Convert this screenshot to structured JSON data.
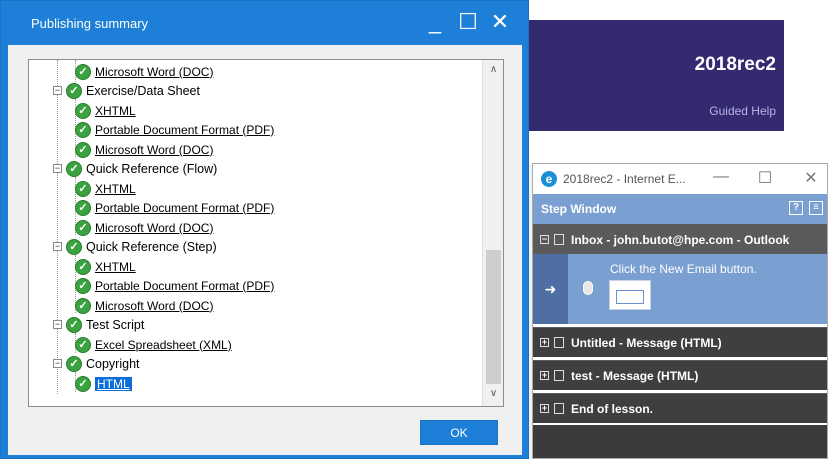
{
  "background_app": {
    "title": "2018rec2",
    "subtitle": "Guided Help"
  },
  "dialog": {
    "title": "Publishing summary",
    "controls": {
      "minimize": "_",
      "maximize": "☐",
      "close": "✕"
    },
    "ok_label": "OK",
    "scroll_up": "∧",
    "scroll_down": "∨",
    "tree": [
      {
        "label": "Microsoft Word (DOC)",
        "kind": "leaf"
      },
      {
        "label": "Exercise/Data Sheet",
        "kind": "node"
      },
      {
        "label": "XHTML",
        "kind": "leaf"
      },
      {
        "label": "Portable Document Format (PDF)",
        "kind": "leaf"
      },
      {
        "label": "Microsoft Word (DOC)",
        "kind": "leaf"
      },
      {
        "label": "Quick Reference (Flow)",
        "kind": "node"
      },
      {
        "label": "XHTML",
        "kind": "leaf"
      },
      {
        "label": "Portable Document Format (PDF)",
        "kind": "leaf"
      },
      {
        "label": "Microsoft Word (DOC)",
        "kind": "leaf"
      },
      {
        "label": "Quick Reference (Step)",
        "kind": "node"
      },
      {
        "label": "XHTML",
        "kind": "leaf"
      },
      {
        "label": "Portable Document Format (PDF)",
        "kind": "leaf"
      },
      {
        "label": "Microsoft Word (DOC)",
        "kind": "leaf"
      },
      {
        "label": "Test Script",
        "kind": "node"
      },
      {
        "label": "Excel Spreadsheet (XML)",
        "kind": "leaf"
      },
      {
        "label": "Copyright",
        "kind": "node"
      },
      {
        "label": "HTML",
        "kind": "leaf",
        "selected": true
      }
    ]
  },
  "ie_window": {
    "title": "2018rec2 - Internet E...",
    "controls": {
      "minimize": "—",
      "maximize": "☐",
      "close": "✕"
    },
    "step_window_label": "Step Window",
    "sections": [
      {
        "label": "Inbox - john.butot@hpe.com - Outlook",
        "toggle": "−"
      },
      {
        "label": "Untitled - Message (HTML)",
        "toggle": "+"
      },
      {
        "label": "test - Message (HTML)",
        "toggle": "+"
      },
      {
        "label": "End of lesson.",
        "toggle": "+"
      }
    ],
    "active_step_text": "Click the New Email button.",
    "active_arrow": "➜"
  }
}
